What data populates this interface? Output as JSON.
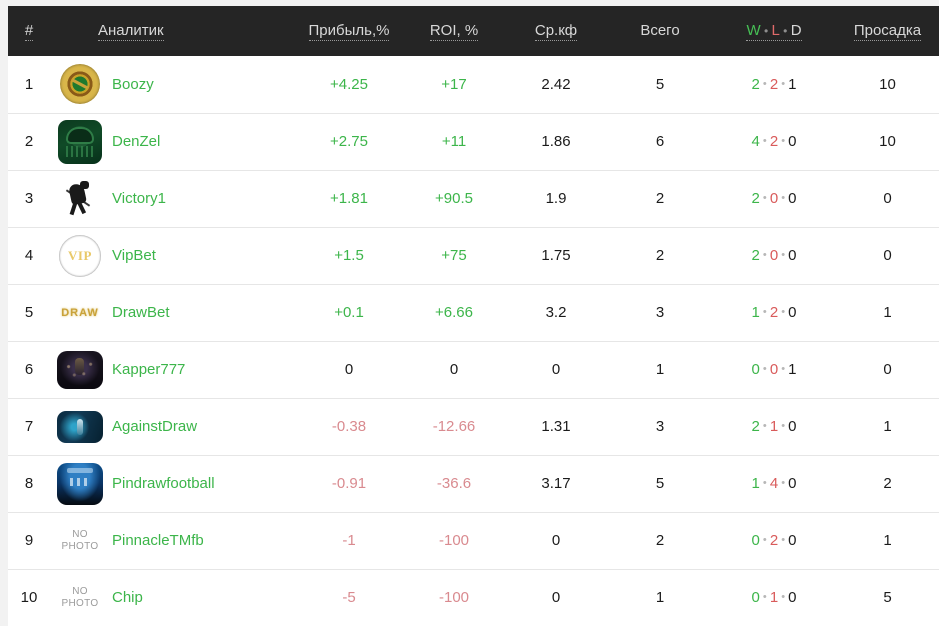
{
  "table": {
    "columns": [
      {
        "key": "rank",
        "label": "#",
        "sortable": true,
        "underlined": true
      },
      {
        "key": "name",
        "label": "Аналитик",
        "sortable": true,
        "underlined": true
      },
      {
        "key": "profit",
        "label": "Прибыль,%",
        "sortable": true,
        "underlined": true
      },
      {
        "key": "roi",
        "label": "ROI, %",
        "sortable": true,
        "underlined": true
      },
      {
        "key": "avg",
        "label": "Ср.кф",
        "sortable": true,
        "underlined": true
      },
      {
        "key": "total",
        "label": "Всего",
        "sortable": false,
        "underlined": false
      },
      {
        "key": "wld",
        "label": "W · L · D",
        "sortable": true,
        "underlined": true
      },
      {
        "key": "dd",
        "label": "Просадка",
        "sortable": true,
        "underlined": true
      }
    ],
    "wld_header": {
      "w": "W",
      "l": "L",
      "d": "D",
      "separator": "•"
    },
    "no_photo_label": {
      "line1": "NO",
      "line2": "PHOTO"
    },
    "rows": [
      {
        "rank": "1",
        "name": "Boozy",
        "avatar": "roulette-avatar",
        "profit": "+4.25",
        "profit_sign": "pos",
        "roi": "+17",
        "roi_sign": "pos",
        "avg": "2.42",
        "total": "5",
        "w": "2",
        "l": "2",
        "d": "1",
        "dd": "10"
      },
      {
        "rank": "2",
        "name": "DenZel",
        "avatar": "denzel-avatar",
        "profit": "+2.75",
        "profit_sign": "pos",
        "roi": "+11",
        "roi_sign": "pos",
        "avg": "1.86",
        "total": "6",
        "w": "4",
        "l": "2",
        "d": "0",
        "dd": "10"
      },
      {
        "rank": "3",
        "name": "Victory1",
        "avatar": "hockey-player-avatar",
        "profit": "+1.81",
        "profit_sign": "pos",
        "roi": "+90.5",
        "roi_sign": "pos",
        "avg": "1.9",
        "total": "2",
        "w": "2",
        "l": "0",
        "d": "0",
        "dd": "0"
      },
      {
        "rank": "4",
        "name": "VipBet",
        "avatar": "vip-coin-avatar",
        "profit": "+1.5",
        "profit_sign": "pos",
        "roi": "+75",
        "roi_sign": "pos",
        "avg": "1.75",
        "total": "2",
        "w": "2",
        "l": "0",
        "d": "0",
        "dd": "0"
      },
      {
        "rank": "5",
        "name": "DrawBet",
        "avatar": "draw-text-avatar",
        "profit": "+0.1",
        "profit_sign": "pos",
        "roi": "+6.66",
        "roi_sign": "pos",
        "avg": "3.2",
        "total": "3",
        "w": "1",
        "l": "2",
        "d": "0",
        "dd": "1"
      },
      {
        "rank": "6",
        "name": "Kapper777",
        "avatar": "kapper-avatar",
        "profit": "0",
        "profit_sign": "zero",
        "roi": "0",
        "roi_sign": "zero",
        "avg": "0",
        "total": "1",
        "w": "0",
        "l": "0",
        "d": "1",
        "dd": "0"
      },
      {
        "rank": "7",
        "name": "AgainstDraw",
        "avatar": "againstdraw-avatar",
        "profit": "-0.38",
        "profit_sign": "neg",
        "roi": "-12.66",
        "roi_sign": "neg",
        "avg": "1.31",
        "total": "3",
        "w": "2",
        "l": "1",
        "d": "0",
        "dd": "1"
      },
      {
        "rank": "8",
        "name": "Pindrawfootball",
        "avatar": "pindraw-avatar",
        "profit": "-0.91",
        "profit_sign": "neg",
        "roi": "-36.6",
        "roi_sign": "neg",
        "avg": "3.17",
        "total": "5",
        "w": "1",
        "l": "4",
        "d": "0",
        "dd": "2"
      },
      {
        "rank": "9",
        "name": "PinnacleTMfb",
        "avatar": "no-photo",
        "profit": "-1",
        "profit_sign": "neg",
        "roi": "-100",
        "roi_sign": "neg",
        "avg": "0",
        "total": "2",
        "w": "0",
        "l": "2",
        "d": "0",
        "dd": "1"
      },
      {
        "rank": "10",
        "name": "Chip",
        "avatar": "no-photo",
        "profit": "-5",
        "profit_sign": "neg",
        "roi": "-100",
        "roi_sign": "neg",
        "avg": "0",
        "total": "1",
        "w": "0",
        "l": "1",
        "d": "0",
        "dd": "5"
      }
    ]
  },
  "colors": {
    "header_bg": "#252525",
    "header_text": "#d8d8d8",
    "positive": "#3cb54a",
    "negative": "#d98a8f",
    "neutral": "#1b1b1b",
    "win": "#3cb54a",
    "loss": "#d95b5b",
    "draw": "#1b1b1b",
    "link": "#3cb54a",
    "row_border": "#e6e6e6",
    "vip_text": "VIP",
    "draw_text": "DRAW"
  }
}
